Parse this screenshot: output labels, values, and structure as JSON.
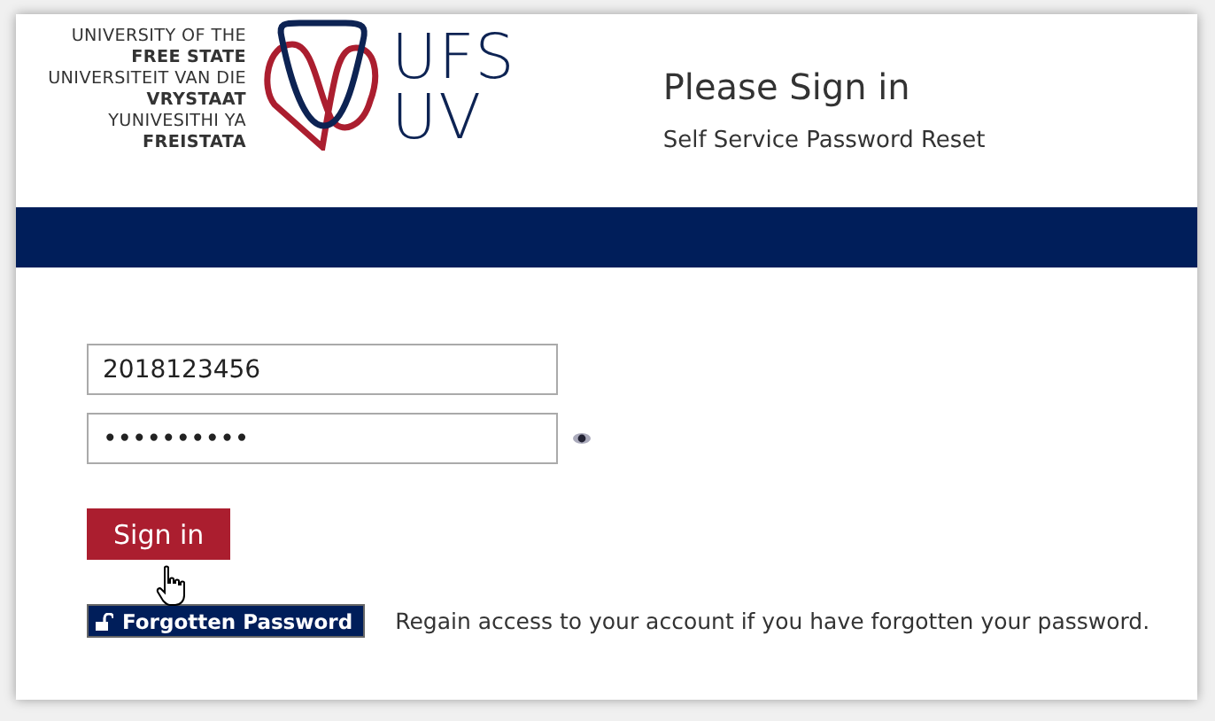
{
  "logo": {
    "lines": [
      {
        "text": "UNIVERSITY OF THE",
        "bold": false
      },
      {
        "text": "FREE STATE",
        "bold": true
      },
      {
        "text": "UNIVERSITEIT VAN DIE",
        "bold": false
      },
      {
        "text": "VRYSTAAT",
        "bold": true
      },
      {
        "text": "YUNIVESITHI YA",
        "bold": false
      },
      {
        "text": "FREISTATA",
        "bold": true
      }
    ],
    "wordmark": [
      "UFS",
      "UV"
    ]
  },
  "header": {
    "title": "Please Sign in",
    "subtitle": "Self Service Password Reset"
  },
  "form": {
    "username": {
      "value": "2018123456"
    },
    "password": {
      "value": "••••••••••"
    },
    "sign_in_button": "Sign in"
  },
  "forgotten": {
    "button": "Forgotten Password",
    "text": "Regain access to your account if you have forgotten your password."
  }
}
